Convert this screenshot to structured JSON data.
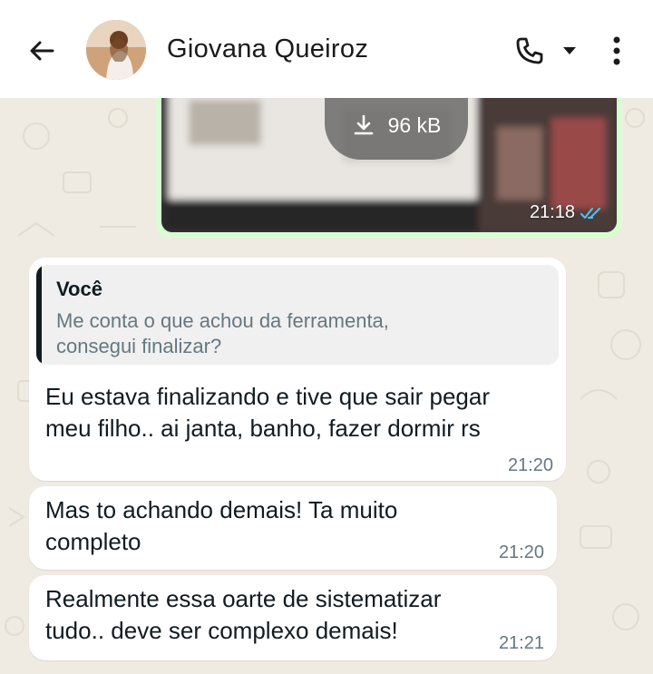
{
  "header": {
    "contact_name": "Giovana Queiroz",
    "back_icon": "arrow-left-icon",
    "call_icon": "phone-icon",
    "dropdown_icon": "caret-down-icon",
    "menu_icon": "more-vertical-icon"
  },
  "media_message": {
    "download_size": "96 kB",
    "time": "21:18",
    "status_icon": "double-check-icon",
    "status_color": "#53bdeb"
  },
  "messages": [
    {
      "quote": {
        "author": "Você",
        "text": "Me conta o que achou da ferramenta,\nconsegui finalizar?"
      },
      "text": "Eu estava finalizando e tive que sair pegar\nmeu filho.. ai janta, banho, fazer dormir rs",
      "time": "21:20"
    },
    {
      "text": "Mas to achando demais! Ta muito\ncompleto",
      "time": "21:20"
    },
    {
      "text": "Realmente essa oarte de sistematizar\ntudo.. deve ser complexo demais!",
      "time": "21:21"
    }
  ],
  "colors": {
    "outgoing_bubble": "#d9fdd3",
    "incoming_bubble": "#ffffff",
    "chat_background": "#efeae2",
    "read_receipt": "#53bdeb"
  }
}
